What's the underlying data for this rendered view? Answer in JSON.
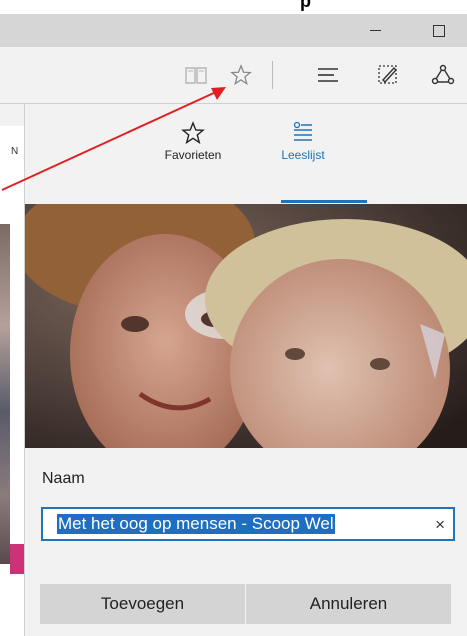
{
  "caption": {
    "text": "p"
  },
  "titlebar": {
    "minimize_label": "—",
    "maximize_label": "□"
  },
  "toolbar": {
    "reading_view_icon": "book-icon",
    "favorite_icon": "star-icon",
    "hub_icon": "hub-icon",
    "note_icon": "web-note-icon",
    "share_icon": "share-icon"
  },
  "page": {
    "partial_letter": "N"
  },
  "panel": {
    "tabs": [
      {
        "label": "Favorieten",
        "icon": "star-icon"
      },
      {
        "label": "Leeslijst",
        "icon": "reading-list-icon"
      }
    ],
    "name_label": "Naam",
    "name_value": "Met het oog op mensen - Scoop Wel",
    "clear_symbol": "×",
    "add_button": "Toevoegen",
    "cancel_button": "Annuleren"
  },
  "colors": {
    "accent": "#1e74b8",
    "arrow": "#e02020",
    "selection": "#1d6fc2"
  }
}
